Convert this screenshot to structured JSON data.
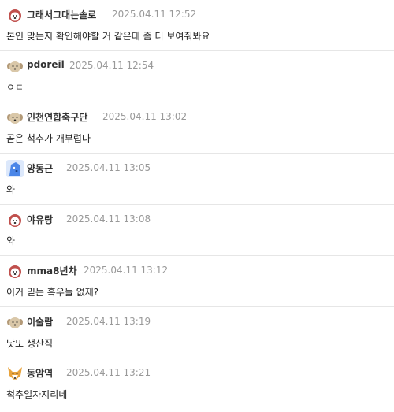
{
  "comments": [
    {
      "nickname": "그래서그대는솔로",
      "datetime": "2025.04.11 12:52",
      "text": "본인 맞는지 확인해야할 거 같은데 좀 더 보여줘봐요",
      "avatar": "dog-face-icon",
      "avatar_color": "#c0504d"
    },
    {
      "nickname": "pdoreil",
      "datetime": "2025.04.11 12:54",
      "text": "ㅇㄷ",
      "avatar": "puppy-face-icon",
      "avatar_color": "#d9c7a8"
    },
    {
      "nickname": "인천연합축구단",
      "datetime": "2025.04.11 13:02",
      "text": "곧은 척추가 개부럽다",
      "avatar": "puppy-face-icon",
      "avatar_color": "#d9c7a8"
    },
    {
      "nickname": "양동근",
      "datetime": "2025.04.11 13:05",
      "text": "와",
      "avatar": "blue-dog-icon",
      "avatar_color": "#4a86e8"
    },
    {
      "nickname": "야유랑",
      "datetime": "2025.04.11 13:08",
      "text": "와",
      "avatar": "dog-face-icon",
      "avatar_color": "#c0504d"
    },
    {
      "nickname": "mma8년차",
      "datetime": "2025.04.11 13:12",
      "text": "이거 믿는 흑우들 없제?",
      "avatar": "dog-face-icon",
      "avatar_color": "#c0504d"
    },
    {
      "nickname": "이술람",
      "datetime": "2025.04.11 13:19",
      "text": "낫또 생산직",
      "avatar": "puppy-face-icon",
      "avatar_color": "#d9c7a8"
    },
    {
      "nickname": "동암역",
      "datetime": "2025.04.11 13:21",
      "text": "척추일자지리네",
      "avatar": "fox-face-icon",
      "avatar_color": "#e8a33d"
    }
  ]
}
